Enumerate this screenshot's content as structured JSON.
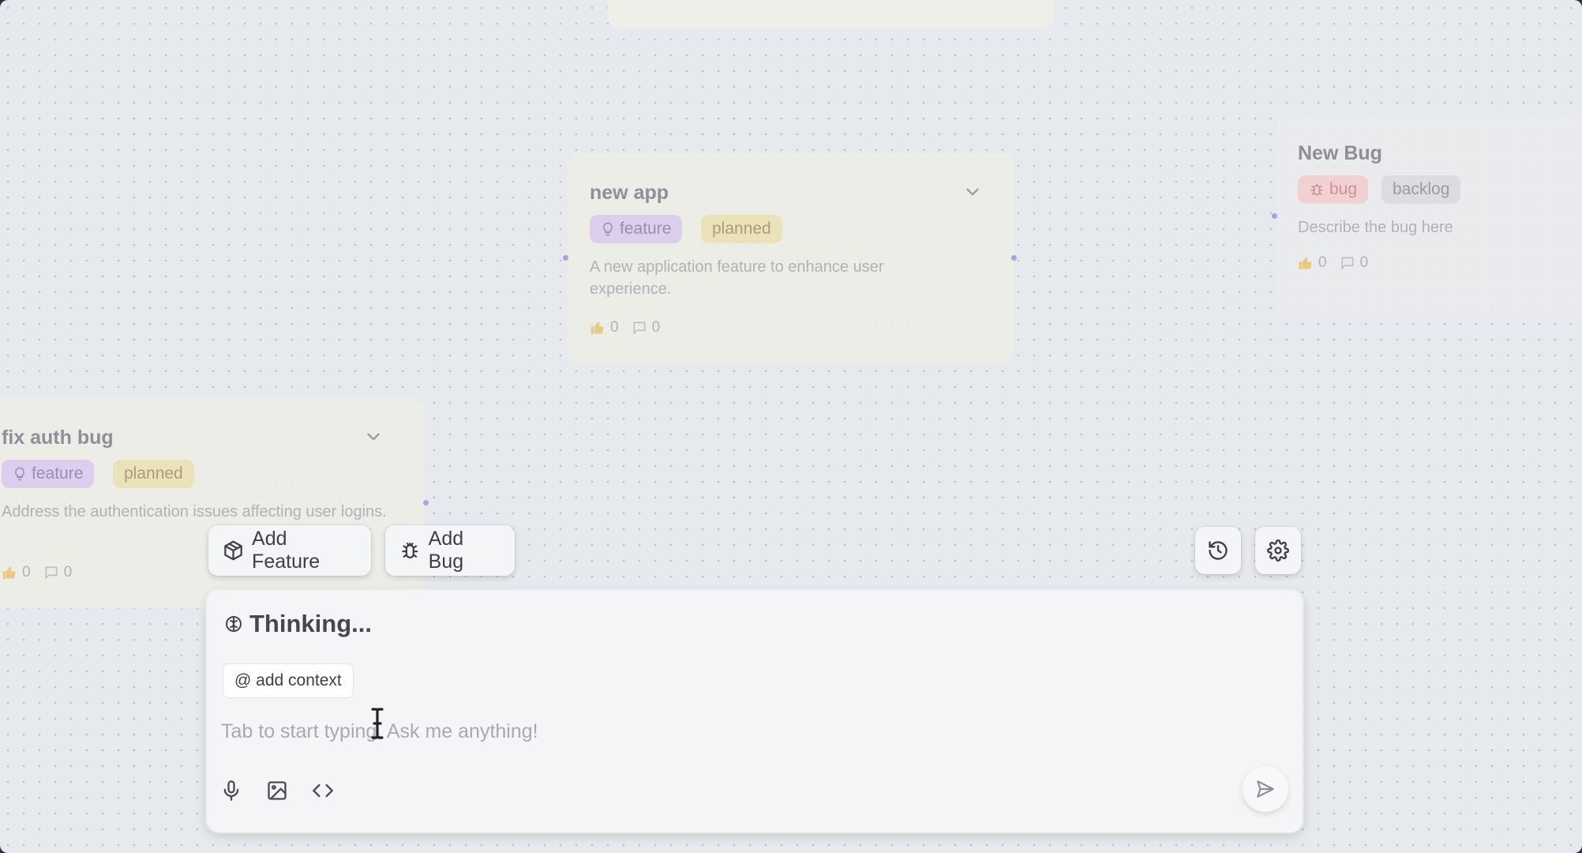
{
  "cards": {
    "new_app": {
      "title": "new app",
      "tags": [
        "feature",
        "planned"
      ],
      "description": "A new application feature to enhance user experience.",
      "likes": "0",
      "comments": "0"
    },
    "new_bug": {
      "title": "New Bug",
      "tags": [
        "bug",
        "backlog"
      ],
      "description": "Describe the bug here",
      "likes": "0",
      "comments": "0"
    },
    "fix_auth": {
      "title": "fix auth bug",
      "tags": [
        "feature",
        "planned"
      ],
      "description": "Address the authentication issues affecting user logins.",
      "likes": "0",
      "comments": "0"
    }
  },
  "toolbar": {
    "add_feature_label": "Add Feature",
    "add_bug_label": "Add Bug",
    "history_icon": "history-icon",
    "settings_icon": "gear-icon"
  },
  "composer": {
    "status": "Thinking...",
    "context_chip": "@ add context",
    "placeholder": "Tab to start typing. Ask me anything!",
    "tools": [
      "microphone-icon",
      "image-icon",
      "code-icon"
    ],
    "send_icon": "send-icon"
  },
  "colors": {
    "feature_tag": "#dcc9ee",
    "planned_tag": "#ece2ae",
    "bug_tag": "#f4cccc",
    "backlog_tag": "#d9dbde",
    "connector_dot": "#a9a0e8"
  }
}
